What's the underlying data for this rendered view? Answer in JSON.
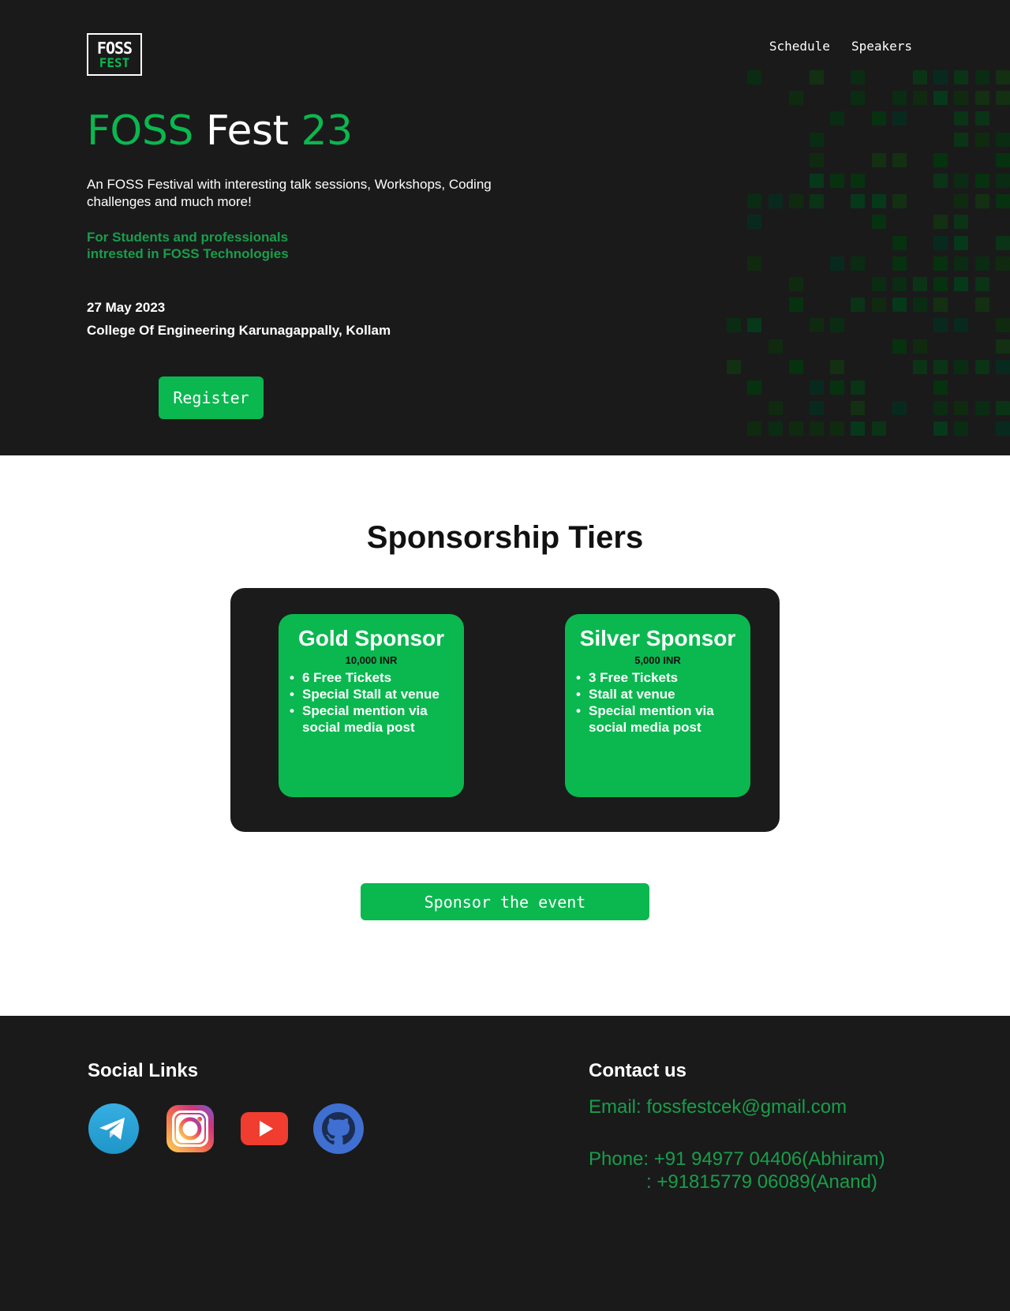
{
  "brand": {
    "logo_line1": "FOSS",
    "logo_line2": "FEST"
  },
  "nav": {
    "items": [
      {
        "label": "Schedule"
      },
      {
        "label": "Speakers"
      }
    ]
  },
  "hero": {
    "title_part1": "FOSS",
    "title_part2": "Fest",
    "title_part3": "23",
    "description": "An FOSS Festival with interesting talk sessions, Workshops, Coding challenges and much more!",
    "audience_line1": "For Students and professionals",
    "audience_line2": "intrested in FOSS Technologies",
    "date": "27 May 2023",
    "venue": "College Of Engineering Karunagappally, Kollam",
    "register_label": "Register"
  },
  "sponsorship": {
    "title": "Sponsorship Tiers",
    "tiers": [
      {
        "name": "Gold Sponsor",
        "price": "10,000 INR",
        "perks": [
          "6 Free Tickets",
          "Special Stall at venue",
          "Special mention via social media post"
        ]
      },
      {
        "name": "Silver Sponsor",
        "price": "5,000 INR",
        "perks": [
          "3 Free Tickets",
          "Stall at venue",
          "Special mention via social media post"
        ]
      }
    ],
    "cta_label": "Sponsor the event"
  },
  "footer": {
    "social_title": "Social Links",
    "social_icons": [
      "telegram-icon",
      "instagram-icon",
      "youtube-icon",
      "github-icon"
    ],
    "contact_title": "Contact us",
    "email": "Email: fossfestcek@gmail.com",
    "phone_line1": "Phone: +91 94977 04406(Abhiram)",
    "phone_line2": ": +91815779 06089(Anand)"
  },
  "colors": {
    "accent": "#0ab84f",
    "accent_text": "#189e4a",
    "dark_bg": "#1a1a1a",
    "light_bg": "#ffffff"
  }
}
